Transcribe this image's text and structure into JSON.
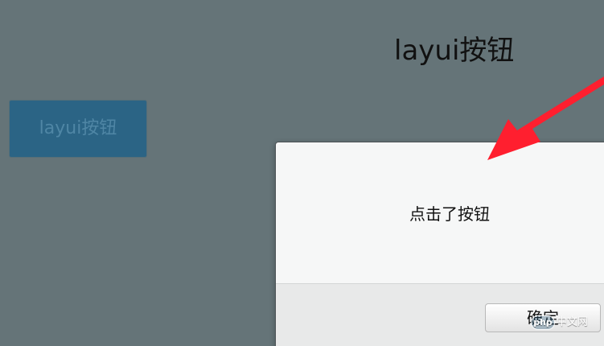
{
  "page": {
    "title": "layui按钮"
  },
  "button": {
    "label": "layui按钮"
  },
  "dialog": {
    "message": "点击了按钮",
    "ok_label": "确定"
  },
  "watermark": {
    "logo": "php",
    "text": "中文网"
  },
  "colors": {
    "backdrop": "#657478",
    "primary_button": "#2b6485",
    "dialog_background": "#f6f7f7",
    "dialog_footer": "#e8e9e9",
    "annotation_arrow": "#ff1f2f"
  },
  "icons": {
    "annotation": "red-arrow-icon"
  }
}
